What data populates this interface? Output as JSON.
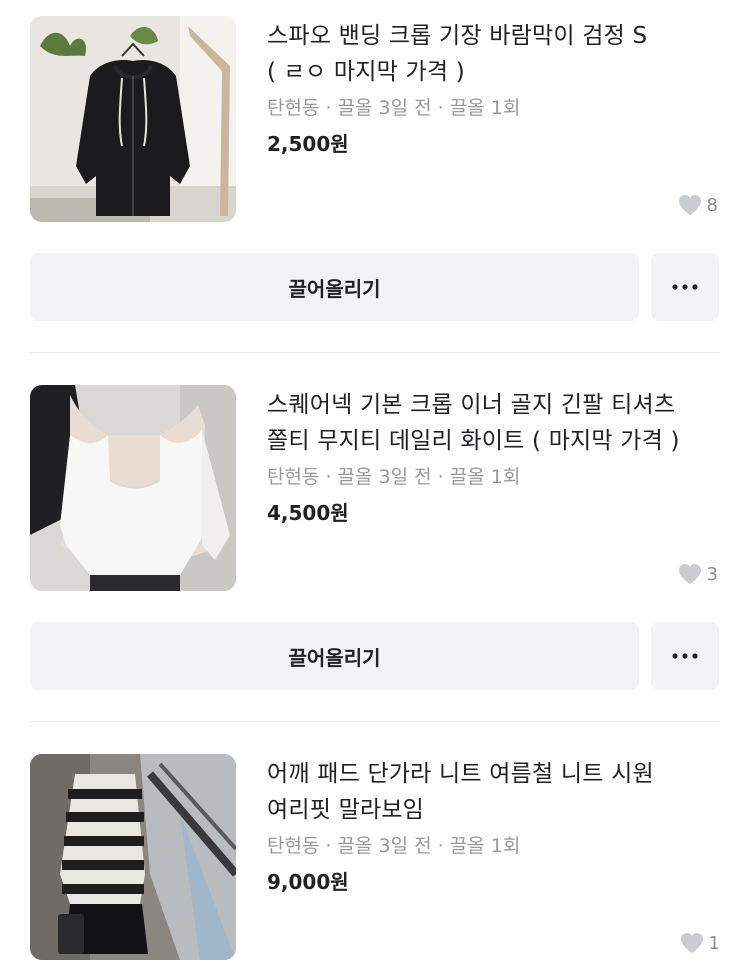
{
  "items": [
    {
      "title_line1": "스파오 밴딩 크롭 기장 바람막이 검정 S",
      "title_line2": "( ㄹㅇ 마지막 가격 )",
      "meta": "탄현동 · 끌올 3일 전 · 끌올 1회",
      "price": "2,500원",
      "likes": "8",
      "bump_label": "끌어올리기",
      "more_label": "···",
      "thumb_icon": "black-hooded-windbreaker-photo"
    },
    {
      "title_line1": "스퀘어넥 기본 크롭 이너 골지 긴팔 티셔츠",
      "title_line2": "쫄티 무지티 데일리 화이트 ( 마지막 가격 )",
      "meta": "탄현동 · 끌올 3일 전 · 끌올 1회",
      "price": "4,500원",
      "likes": "3",
      "bump_label": "끌어올리기",
      "more_label": "···",
      "thumb_icon": "white-crop-top-photo"
    },
    {
      "title_line1": "어깨 패드 단가라 니트 여름철 니트 시원",
      "title_line2": "여리핏 말라보임",
      "meta": "탄현동 · 끌올 3일 전 · 끌올 1회",
      "price": "9,000원",
      "likes": "1",
      "thumb_icon": "striped-knit-photo"
    }
  ],
  "colors": {
    "text": "#212124",
    "meta": "#98989f",
    "button_bg": "#f2f3f6",
    "divider": "#e9ebee",
    "heart": "#c9ccd1"
  }
}
